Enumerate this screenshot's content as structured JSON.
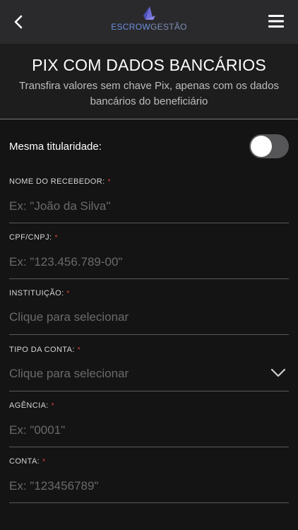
{
  "header": {
    "brand_part1": "ESCROW",
    "brand_part2": "GESTÃO",
    "title": "PIX COM DADOS BANCÁRIOS",
    "subtitle": "Transfira valores sem chave Pix, apenas com os dados bancários do beneficiário"
  },
  "toggle": {
    "label": "Mesma titularidade:",
    "checked": false
  },
  "fields": {
    "nome": {
      "label": "NOME DO RECEBEDOR:",
      "placeholder": "Ex: \"João da Silva\"",
      "value": ""
    },
    "cpf": {
      "label": "CPF/CNPJ:",
      "placeholder": "Ex: \"123.456.789-00\"",
      "value": ""
    },
    "instituicao": {
      "label": "INSTITUIÇÃO:",
      "value": "Clique para selecionar"
    },
    "tipo": {
      "label": "TIPO DA CONTA:",
      "value": "Clique para selecionar"
    },
    "agencia": {
      "label": "AGÊNCIA:",
      "placeholder": "Ex: \"0001\"",
      "value": ""
    },
    "conta": {
      "label": "CONTA:",
      "placeholder": "Ex: \"123456789\"",
      "value": ""
    }
  },
  "required_marker": "*",
  "colors": {
    "background": "#141414",
    "topbar": "#2a2a2c",
    "required": "#e0443e",
    "brand": "#6d8fe0"
  },
  "icons": [
    "back-arrow-icon",
    "hamburger-menu-icon",
    "brand-logo-icon",
    "chevron-down-icon"
  ]
}
